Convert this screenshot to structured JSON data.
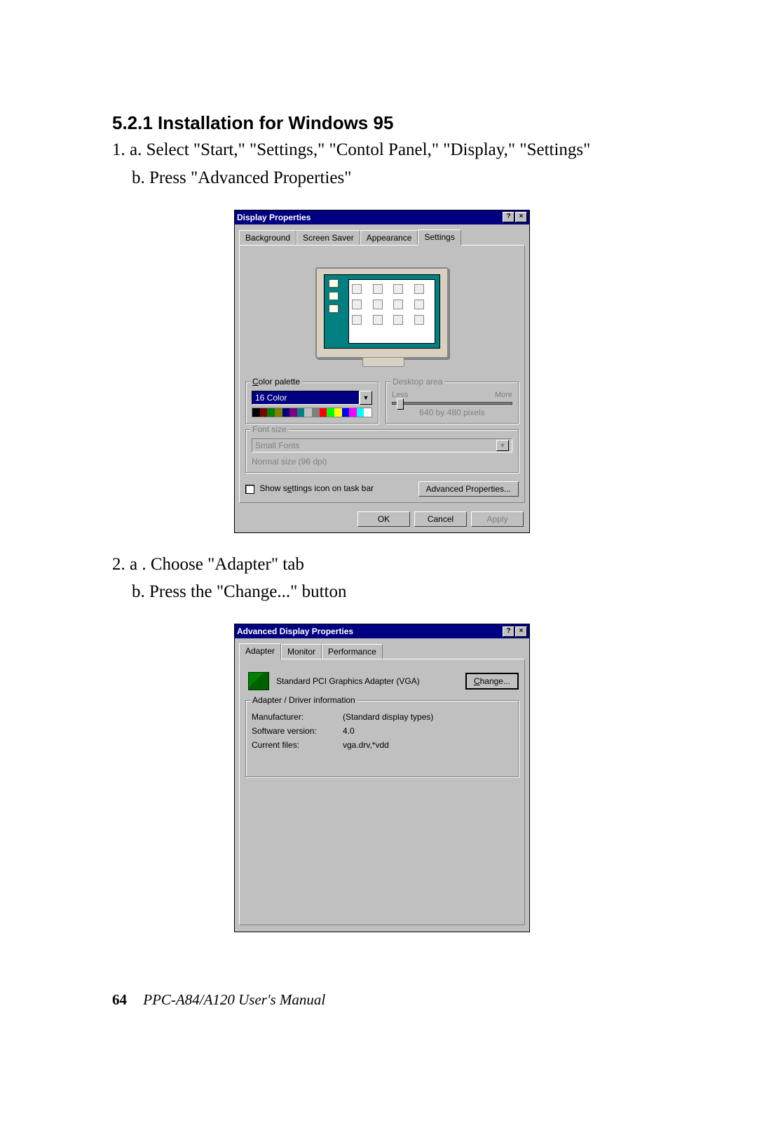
{
  "heading": "5.2.1 Installation for Windows 95",
  "step1_a": "1. a. Select \"Start,\" \"Settings,\" \"Contol Panel,\" \"Display,\" \"Settings\"",
  "step1_b": "b. Press \"Advanced Properties\"",
  "step2_a": "2. a . Choose \"Adapter\" tab",
  "step2_b": "b. Press the \"Change...\" button",
  "footer": {
    "page": "64",
    "manual": "PPC-A84/A120  User's Manual"
  },
  "dialog1": {
    "title": "Display Properties",
    "tabs": {
      "background": "Background",
      "screensaver": "Screen Saver",
      "appearance": "Appearance",
      "settings": "Settings"
    },
    "color_palette_label": "Color palette",
    "color_palette_value": "16 Color",
    "desktop_area_label": "Desktop area",
    "less": "Less",
    "more": "More",
    "resolution": "640 by 480 pixels",
    "font_size_label": "Font size",
    "font_size_value": "Small Fonts",
    "normal_size": "Normal size (96 dpi)",
    "show_settings": "Show settings icon on task bar",
    "advanced": "Advanced Properties...",
    "ok": "OK",
    "cancel": "Cancel",
    "apply": "Apply",
    "palette_colors": [
      "#000000",
      "#800000",
      "#008000",
      "#808000",
      "#000080",
      "#800080",
      "#008080",
      "#c0c0c0",
      "#808080",
      "#ff0000",
      "#00ff00",
      "#ffff00",
      "#0000ff",
      "#ff00ff",
      "#00ffff",
      "#ffffff"
    ]
  },
  "dialog2": {
    "title": "Advanced Display Properties",
    "tabs": {
      "adapter": "Adapter",
      "monitor": "Monitor",
      "performance": "Performance"
    },
    "adapter_name": "Standard PCI Graphics Adapter (VGA)",
    "change": "Change...",
    "group_label": "Adapter / Driver information",
    "rows": {
      "manufacturer_label": "Manufacturer:",
      "manufacturer_value": "(Standard display types)",
      "software_label": "Software version:",
      "software_value": "4.0",
      "files_label": "Current files:",
      "files_value": "vga.drv,*vdd"
    }
  }
}
